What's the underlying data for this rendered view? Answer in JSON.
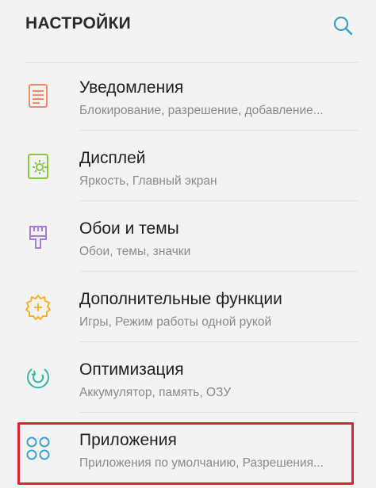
{
  "header": {
    "title": "НАСТРОЙКИ",
    "search_icon": "search-icon"
  },
  "items": [
    {
      "title": "Уведомления",
      "subtitle": "Блокирование, разрешение, добавление...",
      "icon": "notifications-icon",
      "icon_color": "#ee8a6a"
    },
    {
      "title": "Дисплей",
      "subtitle": "Яркость, Главный экран",
      "icon": "display-brightness-icon",
      "icon_color": "#8cc63f"
    },
    {
      "title": "Обои и темы",
      "subtitle": "Обои, темы, значки",
      "icon": "paintbrush-icon",
      "icon_color": "#a77bd6"
    },
    {
      "title": "Дополнительные функции",
      "subtitle": "Игры, Режим работы одной рукой",
      "icon": "gear-plus-icon",
      "icon_color": "#f0b429"
    },
    {
      "title": "Оптимизация",
      "subtitle": "Аккумулятор, память, ОЗУ",
      "icon": "optimization-icon",
      "icon_color": "#39b3a3"
    },
    {
      "title": "Приложения",
      "subtitle": "Приложения по умолчанию, Разрешения...",
      "icon": "apps-grid-icon",
      "icon_color": "#3ba3c9"
    }
  ],
  "highlight_color": "#d9232e"
}
